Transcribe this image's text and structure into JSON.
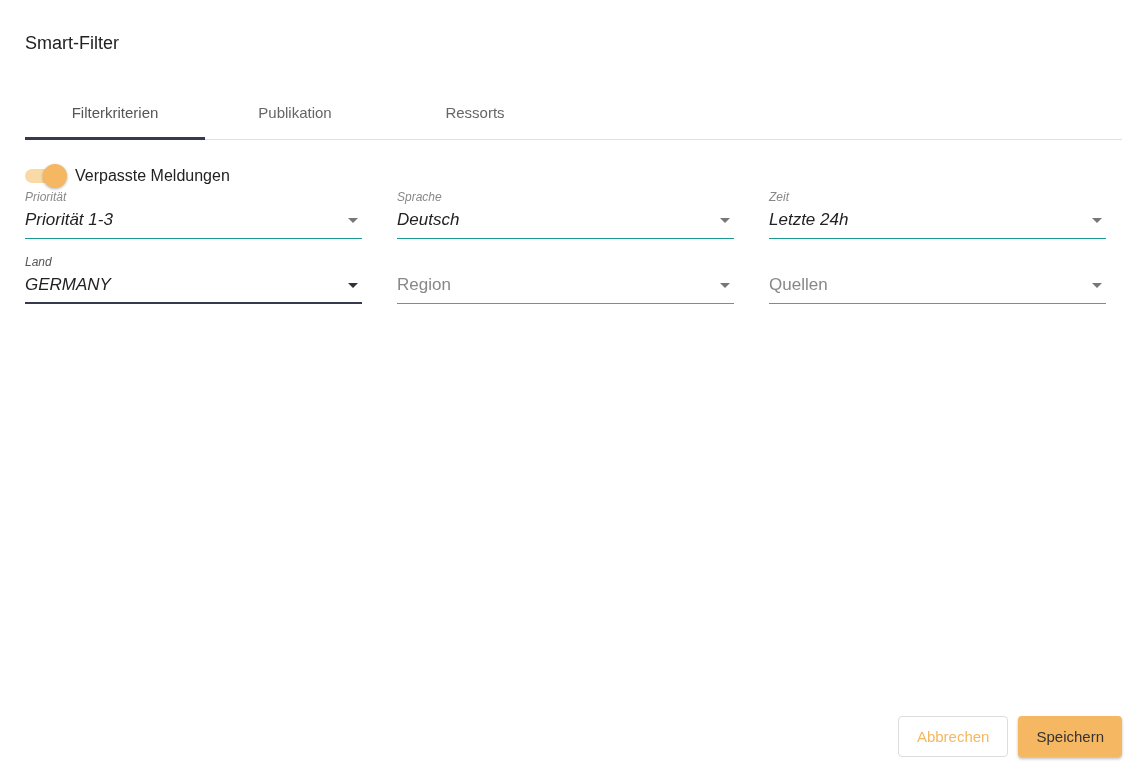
{
  "dialog": {
    "title": "Smart-Filter"
  },
  "tabs": [
    {
      "label": "Filterkriterien",
      "selected": true
    },
    {
      "label": "Publikation",
      "selected": false
    },
    {
      "label": "Ressorts",
      "selected": false
    }
  ],
  "toggle": {
    "label": "Verpasste Meldungen",
    "on": true
  },
  "fields": [
    {
      "label": "Priorität",
      "value": "Priorität 1-3",
      "focused": false
    },
    {
      "label": "Sprache",
      "value": "Deutsch",
      "focused": false
    },
    {
      "label": "Zeit",
      "value": "Letzte 24h",
      "focused": false
    },
    {
      "label": "Land",
      "value": "GERMANY",
      "focused": true
    },
    {
      "placeholder": "Region",
      "focused": false
    },
    {
      "placeholder": "Quellen",
      "focused": false
    }
  ],
  "buttons": [
    {
      "label": "Abbrechen",
      "kind": "outlined"
    },
    {
      "label": "Speichern",
      "kind": "filled"
    }
  ]
}
